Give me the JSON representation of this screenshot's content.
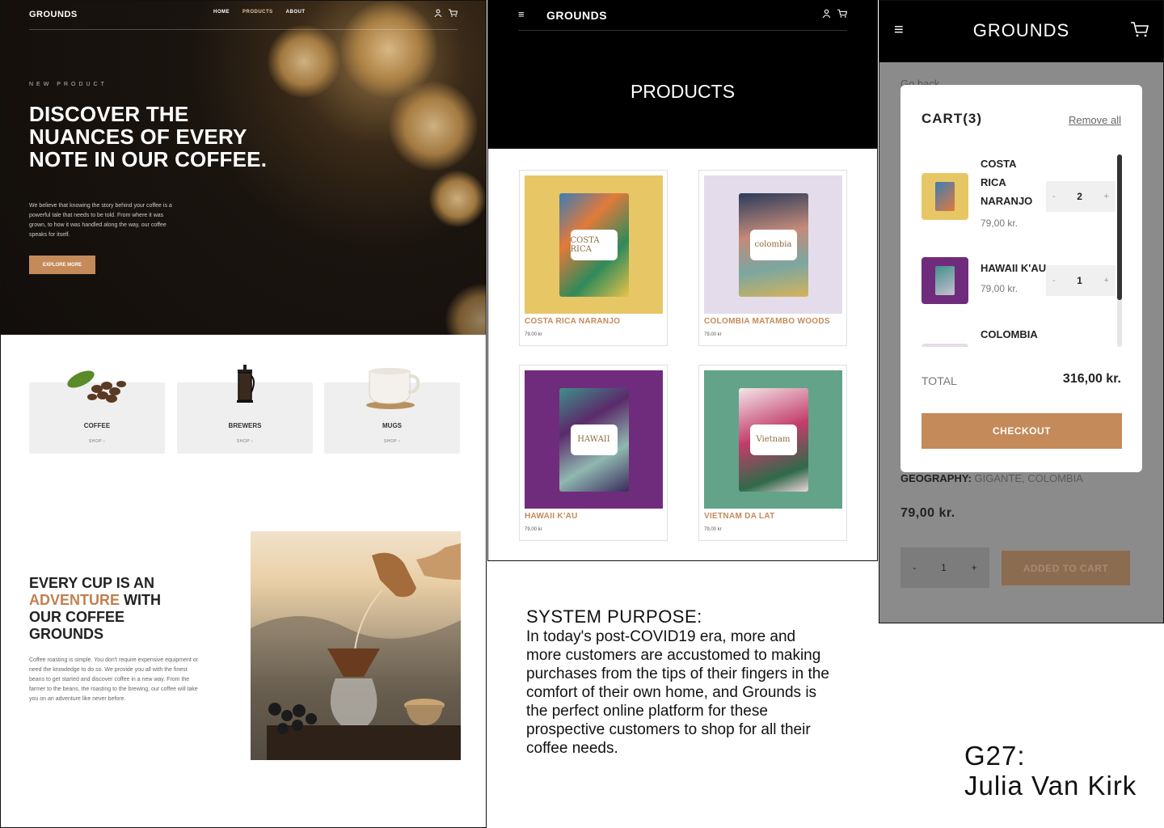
{
  "home": {
    "logo": "GROUNDS",
    "nav": [
      "HOME",
      "PRODUCTS",
      "ABOUT"
    ],
    "eyebrow": "NEW PRODUCT",
    "headline": "DISCOVER THE NUANCES OF EVERY NOTE IN OUR COFFEE.",
    "description": "We believe that knowing the story behind your coffee is a powerful tale that needs to be told. From where it was grown, to how it was handled along the way, our coffee speaks for itself.",
    "cta": "EXPLORE MORE",
    "categories": [
      {
        "title": "COFFEE",
        "link": "SHOP ›"
      },
      {
        "title": "BREWERS",
        "link": "SHOP ›"
      },
      {
        "title": "MUGS",
        "link": "SHOP ›"
      }
    ],
    "story_heading": {
      "line1": "EVERY CUP IS AN",
      "accent": "ADVENTURE",
      "after": " WITH",
      "line3": "OUR COFFEE",
      "line4": "GROUNDS"
    },
    "story_text": "Coffee roasting is simple. You don't require expensive equipment or need the knowledge to do so. We provide you all with the finest beans to get started and discover coffee in a new way. From the farmer to the beans, the roasting to the brewing, our coffee will take you on an adventure like never before."
  },
  "products_page": {
    "logo": "GROUNDS",
    "title": "PRODUCTS",
    "items": [
      {
        "name": "COSTA RICA NARANJO",
        "price": "79,00 kr",
        "label": "COSTA RICA",
        "color": "#e7c765",
        "bag": "#3c7cb6"
      },
      {
        "name": "COLOMBIA MATAMBO WOODS",
        "price": "79,00 kr",
        "label": "colombia",
        "color": "#e4dcea",
        "bag": "#c48a7a"
      },
      {
        "name": "HAWAII K'AU",
        "price": "79,00 kr",
        "label": "HAWAII",
        "color": "#702c7c",
        "bag": "#3f8f8a"
      },
      {
        "name": "VIETNAM DA LAT",
        "price": "79,00 kr",
        "label": "Vietnam",
        "color": "#63a38a",
        "bag": "#c23c6a"
      }
    ]
  },
  "purpose": {
    "heading": "SYSTEM PURPOSE:",
    "text": "In today's post-COVID19 era, more and more customers are accustomed to making purchases from the tips of their fingers in the comfort of their own home, and Grounds is the perfect online platform for these prospective customers to shop for all their coffee needs."
  },
  "cart_screen": {
    "logo": "GROUNDS",
    "go_back": "Go back",
    "geography_label": "GEOGRAPHY:",
    "geography_value": " GIGANTE, COLOMBIA",
    "price": "79,00 kr.",
    "qty": "1",
    "added_btn": "ADDED TO CART",
    "cart": {
      "title": "CART",
      "count": "(3)",
      "remove_all": "Remove all",
      "items": [
        {
          "name": "COSTA RICA NARANJO",
          "name_lines": [
            "COSTA",
            "RICA",
            "NARANJO"
          ],
          "price": "79,00 kr.",
          "qty": "2",
          "color": "#e7c765"
        },
        {
          "name": "HAWAII K'AU",
          "name_lines": [
            "HAWAII K'AU"
          ],
          "price": "79,00 kr.",
          "qty": "1",
          "color": "#702c7c"
        },
        {
          "name": "COLOMBIA",
          "name_lines": [
            "COLOMBIA"
          ],
          "price": "",
          "qty": "",
          "color": "#e4dcea"
        }
      ],
      "total_label": "TOTAL",
      "total_value": "316,00 kr.",
      "checkout": "CHECKOUT"
    }
  },
  "credit": {
    "line1": "G27:",
    "line2": "Julia Van Kirk"
  },
  "icons": [
    "user-icon",
    "cart-icon",
    "hamburger-menu-icon",
    "chevron-right-icon"
  ],
  "colors": {
    "accent": "#c48a5a",
    "dark": "#000000"
  }
}
